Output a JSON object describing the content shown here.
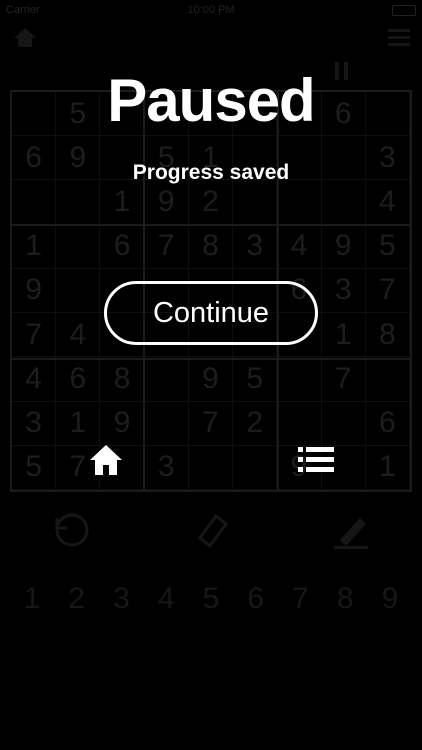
{
  "status_bar": {
    "carrier": "Carrier",
    "time": "10:00 PM"
  },
  "overlay": {
    "title": "Paused",
    "subtitle": "Progress saved",
    "continue_label": "Continue"
  },
  "board": {
    "cells": [
      [
        "",
        "5",
        "",
        "",
        "",
        "",
        "",
        "6",
        ""
      ],
      [
        "6",
        "9",
        "",
        "5",
        "1",
        "",
        "",
        "",
        "3"
      ],
      [
        "",
        "",
        "1",
        "9",
        "2",
        "",
        "",
        "",
        "4"
      ],
      [
        "1",
        "",
        "6",
        "7",
        "8",
        "3",
        "4",
        "9",
        "5"
      ],
      [
        "9",
        "",
        "",
        "",
        "",
        "",
        "6",
        "3",
        "7"
      ],
      [
        "7",
        "4",
        "",
        "",
        "",
        "",
        "",
        "1",
        "8"
      ],
      [
        "4",
        "6",
        "8",
        "",
        "9",
        "5",
        "",
        "7",
        ""
      ],
      [
        "3",
        "1",
        "9",
        "",
        "7",
        "2",
        "",
        "",
        "6"
      ],
      [
        "5",
        "7",
        "",
        "3",
        "",
        "",
        "9",
        "",
        "1"
      ]
    ]
  },
  "numpad": [
    "1",
    "2",
    "3",
    "4",
    "5",
    "6",
    "7",
    "8",
    "9"
  ],
  "colors": {
    "overlay_text": "#ffffff",
    "background": "#000000"
  }
}
